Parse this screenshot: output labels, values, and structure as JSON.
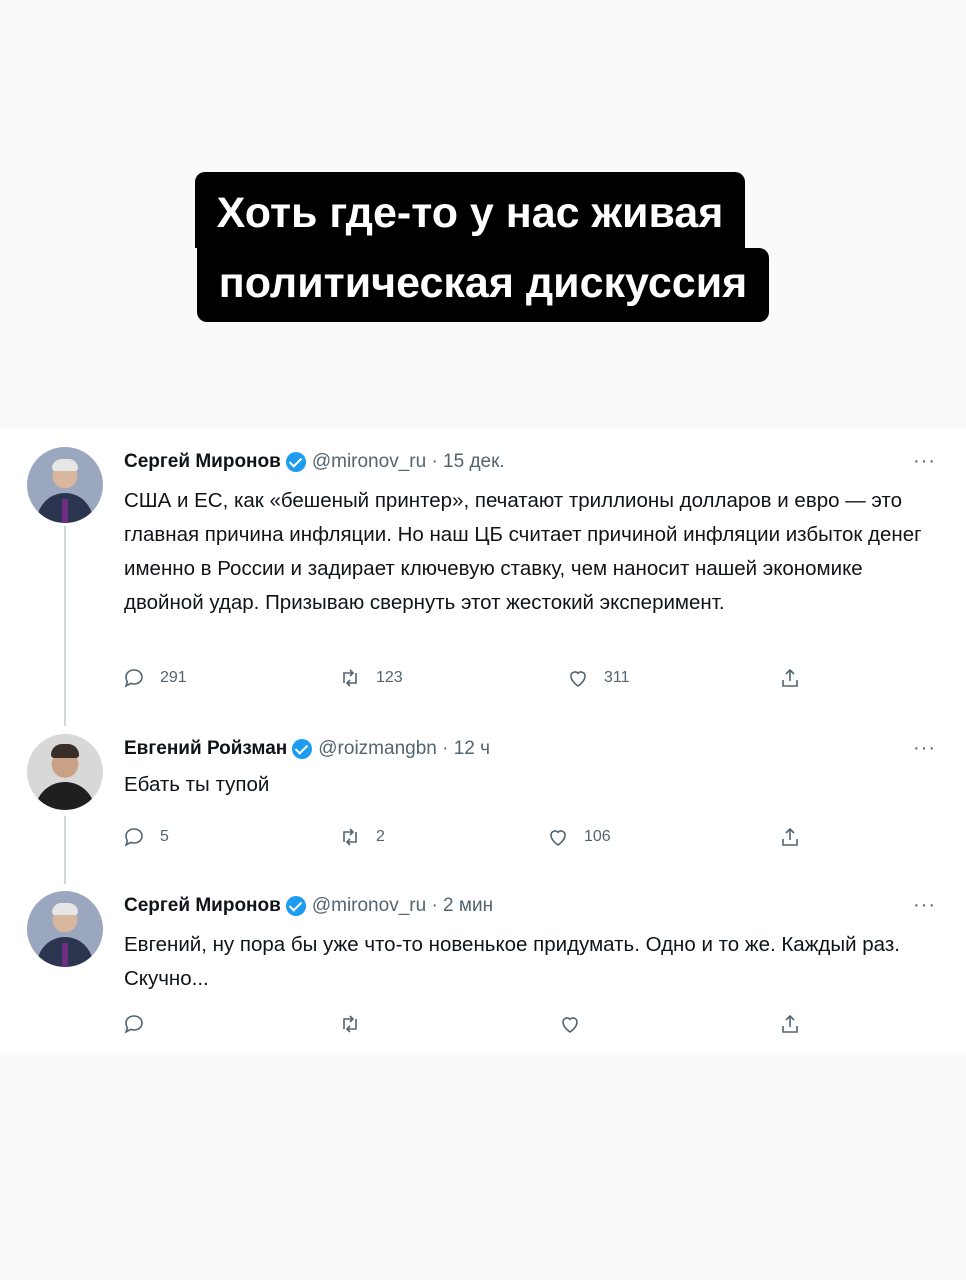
{
  "caption": {
    "line1": "Хоть где-то у нас живая",
    "line2": "политическая дискуссия"
  },
  "tweets": [
    {
      "name": "Сергей Миронов",
      "handle": "@mironov_ru",
      "sep": "·",
      "time": "15 дек.",
      "more": "···",
      "text": "США и ЕС, как «бешеный принтер», печатают триллионы долларов и евро — это главная причина инфляции. Но наш ЦБ считает причиной инфляции избыток денег именно в России и задирает ключевую ставку, чем наносит нашей экономике двойной удар. Призываю свернуть этот жестокий эксперимент.",
      "replies": "291",
      "retweets": "123",
      "likes": "311"
    },
    {
      "name": "Евгений Ройзман",
      "handle": "@roizmangbn",
      "sep": "·",
      "time": "12 ч",
      "more": "···",
      "text": "Ебать ты тупой",
      "replies": "5",
      "retweets": "2",
      "likes": "106"
    },
    {
      "name": "Сергей Миронов",
      "handle": "@mironov_ru",
      "sep": "·",
      "time": "2 мин",
      "more": "···",
      "text": "Евгений, ну пора бы уже что-то новенькое придумать. Одно и то же. Каждый раз. Скучно...",
      "replies": "",
      "retweets": "",
      "likes": ""
    }
  ],
  "icons": [
    "reply-icon",
    "retweet-icon",
    "like-icon",
    "share-icon",
    "verified-badge-icon",
    "more-icon"
  ],
  "colors": {
    "caption_bg": "#000000",
    "caption_text": "#ffffff",
    "verified": "#1d9bf0",
    "muted": "#536471"
  }
}
